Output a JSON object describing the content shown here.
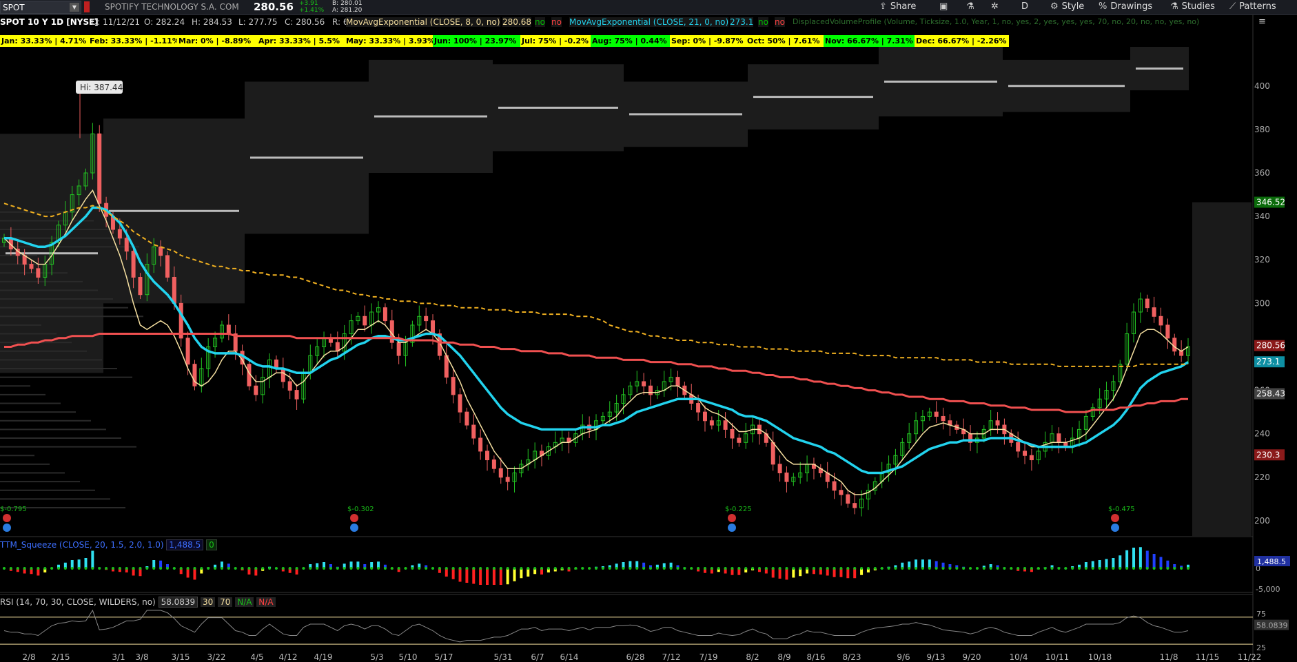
{
  "header": {
    "symbol": "SPOT",
    "company": "SPOTIFY TECHNOLOGY S.A. COM",
    "last": "280.56",
    "change": "+3.91",
    "change_pct": "+1.41%",
    "bid": "B: 280.01",
    "ask": "A: 281.20",
    "ohlc": {
      "date": "D: 11/12/21",
      "open": "O: 282.24",
      "high": "H: 284.53",
      "low": "L: 277.75",
      "close": "C: 280.56",
      "range": "R: 6.78"
    },
    "toolbar": [
      {
        "label": "Share",
        "icon": "share-icon",
        "glyph": "⇪"
      },
      {
        "label": "",
        "icon": "monitor-icon",
        "glyph": "▣"
      },
      {
        "label": "",
        "icon": "flask-icon",
        "glyph": "⚗"
      },
      {
        "label": "",
        "icon": "gear-icon",
        "glyph": "✲"
      },
      {
        "label": "D",
        "icon": "",
        "glyph": ""
      },
      {
        "label": "Style",
        "icon": "style-icon",
        "glyph": "⚙"
      },
      {
        "label": "Drawings",
        "icon": "percent-icon",
        "glyph": "%"
      },
      {
        "label": "Studies",
        "icon": "studies-flask-icon",
        "glyph": "⚗"
      },
      {
        "label": "Patterns",
        "icon": "patterns-icon",
        "glyph": "⟋"
      }
    ],
    "menu_icon": "≡"
  },
  "study_bar": {
    "title": "SPOT 10 Y 1D [NYSE]",
    "items": [
      {
        "text": "MovAvgExponential (CLOSE, 8, 0, no)",
        "color": "#f5dfa0"
      },
      {
        "text": "280.68",
        "color": "#f5dfa0"
      },
      {
        "text": "no",
        "color": "#00c000"
      },
      {
        "text": "no",
        "color": "#ff4040"
      },
      {
        "text": "MovAvgExponential (CLOSE, 21, 0, no)",
        "color": "#22d3ee"
      },
      {
        "text": "273.1",
        "color": "#22d3ee"
      },
      {
        "text": "no",
        "color": "#00c000"
      },
      {
        "text": "no",
        "color": "#ff4040"
      },
      {
        "text": "DisplacedVolumeProfile (Volume, Ticksize, 1.0, Year, 1, no, yes, 2, yes, yes, yes, 70, no, 20, no, no, yes, no)",
        "color": "#2e6f2e"
      }
    ]
  },
  "seasonality": [
    {
      "text": "Jan: 33.33% | 4.71%",
      "color": "#ffff00"
    },
    {
      "text": "Feb: 33.33% | -1.11%",
      "color": "#ffff00"
    },
    {
      "text": "Mar: 0% | -8.89%",
      "color": "#ffff00"
    },
    {
      "text": "Apr: 33.33% | 5.5%",
      "color": "#ffff00"
    },
    {
      "text": "May: 33.33% | 3.93%",
      "color": "#ffff00"
    },
    {
      "text": "Jun: 100% | 23.97%",
      "color": "#00ff00"
    },
    {
      "text": "Jul: 75% | -0.2%",
      "color": "#ffff00"
    },
    {
      "text": "Aug: 75% | 0.44%",
      "color": "#00ff00"
    },
    {
      "text": "Sep: 0% | -9.87%",
      "color": "#ffff00"
    },
    {
      "text": "Oct: 50% | 7.61%",
      "color": "#ffff00"
    },
    {
      "text": "Nov: 66.67% | 7.31%",
      "color": "#00ff00"
    },
    {
      "text": "Dec: 66.67% | -2.26%",
      "color": "#ffff00"
    }
  ],
  "chart_data": [
    {
      "type": "candlestick",
      "title": "SPOT 10 Y 1D [NYSE]",
      "ylim": [
        193,
        418
      ],
      "y_ticks": [
        200,
        220,
        240,
        260,
        280,
        300,
        320,
        340,
        360,
        380,
        400
      ],
      "x_tick_labels": [
        "2/8",
        "2/15",
        "3/1",
        "3/8",
        "3/15",
        "3/22",
        "4/5",
        "4/12",
        "4/19",
        "5/3",
        "5/10",
        "5/17",
        "5/31",
        "6/7",
        "6/14",
        "6/28",
        "7/12",
        "7/19",
        "8/2",
        "8/9",
        "8/16",
        "8/23",
        "9/6",
        "9/13",
        "9/20",
        "10/4",
        "10/11",
        "10/18",
        "11/8",
        "11/15",
        "11/22"
      ],
      "high_label": "Hi: 387.44",
      "price_labels": [
        {
          "text": "346.52",
          "value": 346.52,
          "color": "#0b6b0b"
        },
        {
          "text": "280.56",
          "value": 280.56,
          "color": "#8b1a1a"
        },
        {
          "text": "273.1",
          "value": 273.1,
          "color": "#0e8fa3"
        },
        {
          "text": "258.43",
          "value": 258.43,
          "color": "#444444"
        },
        {
          "text": "230.3",
          "value": 230.3,
          "color": "#8b1a1a"
        }
      ],
      "dividend_labels": [
        "$-0.795",
        "$-0.302",
        "$-0.225",
        "$-0.475"
      ],
      "close": [
        330,
        325,
        322,
        318,
        316,
        312,
        318,
        328,
        336,
        342,
        350,
        354,
        360,
        378,
        346,
        340,
        334,
        330,
        324,
        312,
        304,
        318,
        326,
        322,
        312,
        300,
        284,
        272,
        262,
        270,
        280,
        284,
        290,
        286,
        278,
        272,
        262,
        258,
        266,
        274,
        270,
        264,
        260,
        256,
        268,
        276,
        280,
        284,
        282,
        278,
        286,
        292,
        294,
        290,
        296,
        298,
        292,
        282,
        276,
        282,
        290,
        294,
        292,
        286,
        276,
        266,
        258,
        250,
        244,
        238,
        232,
        228,
        224,
        220,
        218,
        222,
        226,
        228,
        232,
        230,
        234,
        236,
        238,
        236,
        240,
        244,
        242,
        246,
        248,
        250,
        254,
        258,
        262,
        264,
        262,
        258,
        260,
        264,
        266,
        262,
        258,
        254,
        250,
        246,
        244,
        246,
        242,
        238,
        236,
        240,
        244,
        240,
        236,
        226,
        222,
        218,
        220,
        222,
        226,
        224,
        222,
        218,
        214,
        212,
        208,
        206,
        210,
        214,
        218,
        222,
        226,
        230,
        236,
        240,
        246,
        248,
        250,
        248,
        246,
        244,
        242,
        240,
        236,
        238,
        242,
        246,
        244,
        240,
        236,
        232,
        230,
        228,
        232,
        236,
        240,
        236,
        234,
        238,
        242,
        248,
        252,
        256,
        260,
        264,
        272,
        286,
        296,
        302,
        298,
        294,
        290,
        284,
        278,
        276,
        280
      ],
      "series": [
        {
          "name": "MovAvgExponential (CLOSE, 8, 0, no)",
          "color": "#f5dfa0",
          "values": [
            330,
            327,
            324,
            322,
            320,
            318,
            318,
            322,
            327,
            332,
            338,
            343,
            348,
            352,
            345,
            338,
            330,
            322,
            312,
            300,
            290,
            288,
            290,
            292,
            290,
            285,
            278,
            270,
            264,
            262,
            264,
            268,
            274,
            278,
            278,
            274,
            268,
            264,
            264,
            266,
            268,
            268,
            266,
            262,
            264,
            268,
            272,
            276,
            278,
            278,
            280,
            284,
            288,
            288,
            290,
            292,
            290,
            286,
            282,
            282,
            284,
            286,
            288,
            286,
            282,
            276,
            270,
            264,
            256,
            250,
            244,
            238,
            232,
            228,
            224,
            224,
            224,
            226,
            228,
            230,
            232,
            234,
            236,
            236,
            238,
            240,
            241,
            242,
            244,
            246,
            248,
            252,
            255,
            258,
            259,
            259,
            259,
            260,
            262,
            262,
            260,
            258,
            256,
            252,
            250,
            249,
            247,
            244,
            241,
            241,
            242,
            242,
            240,
            236,
            232,
            228,
            226,
            226,
            226,
            226,
            224,
            222,
            220,
            218,
            214,
            212,
            212,
            213,
            215,
            218,
            221,
            224,
            228,
            232,
            236,
            240,
            243,
            244,
            245,
            244,
            243,
            242,
            240,
            240,
            240,
            242,
            242,
            242,
            240,
            238,
            236,
            234,
            234,
            235,
            236,
            236,
            236,
            237,
            238,
            240,
            244,
            248,
            252,
            256,
            262,
            270,
            278,
            286,
            288,
            288,
            286,
            283,
            280,
            278,
            280
          ]
        },
        {
          "name": "MovAvgExponential (CLOSE, 21, 0, no)",
          "color": "#22d3ee",
          "values": [
            330,
            330,
            329,
            328,
            327,
            326,
            326,
            327,
            329,
            331,
            334,
            337,
            340,
            344,
            344,
            343,
            340,
            337,
            332,
            326,
            319,
            314,
            310,
            307,
            304,
            300,
            295,
            290,
            284,
            280,
            278,
            277,
            277,
            277,
            277,
            276,
            274,
            272,
            271,
            271,
            270,
            270,
            269,
            268,
            268,
            268,
            270,
            272,
            274,
            275,
            277,
            279,
            281,
            282,
            284,
            285,
            285,
            284,
            283,
            283,
            284,
            285,
            286,
            286,
            285,
            282,
            279,
            276,
            272,
            268,
            264,
            260,
            256,
            252,
            249,
            247,
            245,
            244,
            243,
            242,
            242,
            242,
            242,
            242,
            242,
            243,
            243,
            243,
            244,
            244,
            245,
            246,
            248,
            250,
            251,
            252,
            253,
            254,
            255,
            256,
            256,
            256,
            256,
            255,
            254,
            253,
            252,
            251,
            249,
            248,
            248,
            247,
            246,
            244,
            242,
            240,
            238,
            237,
            236,
            235,
            234,
            232,
            231,
            229,
            227,
            225,
            223,
            222,
            222,
            222,
            223,
            224,
            225,
            227,
            229,
            231,
            233,
            234,
            235,
            236,
            236,
            237,
            237,
            237,
            237,
            238,
            238,
            238,
            238,
            237,
            236,
            235,
            234,
            234,
            234,
            234,
            234,
            234,
            235,
            236,
            238,
            240,
            242,
            244,
            247,
            251,
            256,
            261,
            264,
            266,
            268,
            269,
            270,
            271,
            273
          ]
        },
        {
          "name": "Moving average (red)",
          "color": "#f05050",
          "values": [
            280,
            280,
            281,
            281,
            282,
            282,
            283,
            283,
            284,
            284,
            285,
            285,
            285,
            285,
            286,
            286,
            286,
            286,
            286,
            286,
            286,
            286,
            286,
            286,
            286,
            286,
            286,
            286,
            286,
            286,
            286,
            286,
            286,
            286,
            285,
            285,
            285,
            285,
            285,
            285,
            285,
            285,
            285,
            284,
            284,
            284,
            284,
            284,
            284,
            284,
            284,
            284,
            284,
            284,
            284,
            284,
            284,
            284,
            284,
            283,
            283,
            283,
            283,
            283,
            282,
            282,
            282,
            281,
            281,
            281,
            280,
            280,
            280,
            279,
            279,
            279,
            278,
            278,
            278,
            278,
            277,
            277,
            277,
            276,
            276,
            276,
            276,
            275,
            275,
            275,
            275,
            274,
            274,
            274,
            274,
            273,
            273,
            273,
            273,
            272,
            272,
            272,
            271,
            271,
            271,
            270,
            270,
            269,
            269,
            269,
            268,
            268,
            267,
            267,
            266,
            266,
            266,
            265,
            265,
            264,
            264,
            263,
            263,
            262,
            262,
            261,
            261,
            260,
            260,
            259,
            259,
            258,
            258,
            257,
            257,
            257,
            256,
            256,
            256,
            255,
            255,
            255,
            254,
            254,
            254,
            253,
            253,
            253,
            252,
            252,
            252,
            251,
            251,
            251,
            251,
            251,
            250,
            250,
            250,
            250,
            251,
            251,
            251,
            251,
            252,
            252,
            253,
            253,
            254,
            254,
            255,
            255,
            255,
            256,
            256
          ]
        },
        {
          "name": "Moving average (dashed orange)",
          "color": "#f0b020",
          "values": [
            346,
            345,
            344,
            343,
            342,
            341,
            340,
            340,
            341,
            342,
            343,
            344,
            344,
            345,
            344,
            342,
            340,
            338,
            336,
            333,
            331,
            329,
            327,
            326,
            325,
            324,
            322,
            321,
            320,
            319,
            318,
            317,
            317,
            316,
            316,
            315,
            315,
            314,
            314,
            313,
            313,
            313,
            312,
            312,
            311,
            310,
            309,
            308,
            307,
            306,
            306,
            305,
            304,
            304,
            303,
            303,
            302,
            302,
            301,
            301,
            301,
            300,
            300,
            300,
            299,
            299,
            299,
            298,
            298,
            298,
            298,
            297,
            297,
            297,
            297,
            296,
            296,
            296,
            296,
            295,
            295,
            295,
            295,
            295,
            294,
            294,
            294,
            293,
            292,
            290,
            289,
            288,
            287,
            287,
            286,
            285,
            285,
            284,
            284,
            283,
            283,
            283,
            282,
            282,
            282,
            281,
            281,
            281,
            280,
            280,
            280,
            280,
            279,
            279,
            279,
            279,
            278,
            278,
            278,
            278,
            278,
            277,
            277,
            277,
            277,
            277,
            276,
            276,
            276,
            276,
            276,
            275,
            275,
            275,
            275,
            275,
            275,
            275,
            274,
            274,
            274,
            274,
            274,
            273,
            273,
            273,
            273,
            273,
            272,
            272,
            272,
            272,
            272,
            272,
            272,
            271,
            271,
            271,
            271,
            271,
            271,
            271,
            271,
            271,
            271,
            271,
            271,
            272,
            272,
            272,
            272,
            272,
            272,
            272,
            272
          ]
        }
      ]
    },
    {
      "type": "bar",
      "title": "TTM_Squeeze (CLOSE, 20, 1.5, 2.0, 1.0)",
      "value_label": "1,488.5",
      "extra_label": "0",
      "y_ticks": [
        "1,488.5",
        "0",
        "-5,000"
      ],
      "ylim": [
        -5000,
        5000
      ]
    },
    {
      "type": "line",
      "title": "RSI (14, 70, 30, CLOSE, WILDERS, no)",
      "value": "58.0839",
      "overbought": "70",
      "oversold": "30",
      "na1": "N/A",
      "na2": "N/A",
      "y_ticks": [
        "75",
        "58.0839",
        "25"
      ],
      "ylim": [
        25,
        80
      ]
    }
  ]
}
